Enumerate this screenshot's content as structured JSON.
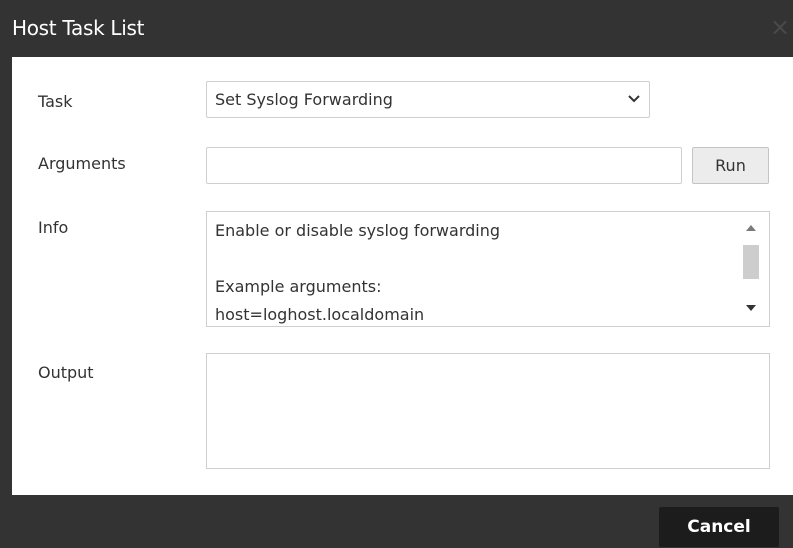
{
  "dialog": {
    "title": "Host Task List",
    "close_icon": "close-icon"
  },
  "form": {
    "task_label": "Task",
    "task_value": "Set Syslog Forwarding",
    "arguments_label": "Arguments",
    "arguments_value": "",
    "run_label": "Run",
    "info_label": "Info",
    "info_text": "Enable or disable syslog forwarding\n\nExample arguments:\nhost=loghost.localdomain",
    "output_label": "Output",
    "output_value": ""
  },
  "footer": {
    "cancel_label": "Cancel"
  },
  "colors": {
    "titlebar": "#333333",
    "body": "#ffffff",
    "label_text": "#333333",
    "border": "#cfcfcf",
    "run_button_bg": "#ececec",
    "cancel_button_bg": "#1c1c1c",
    "scroll_thumb": "#cdcdcd"
  }
}
